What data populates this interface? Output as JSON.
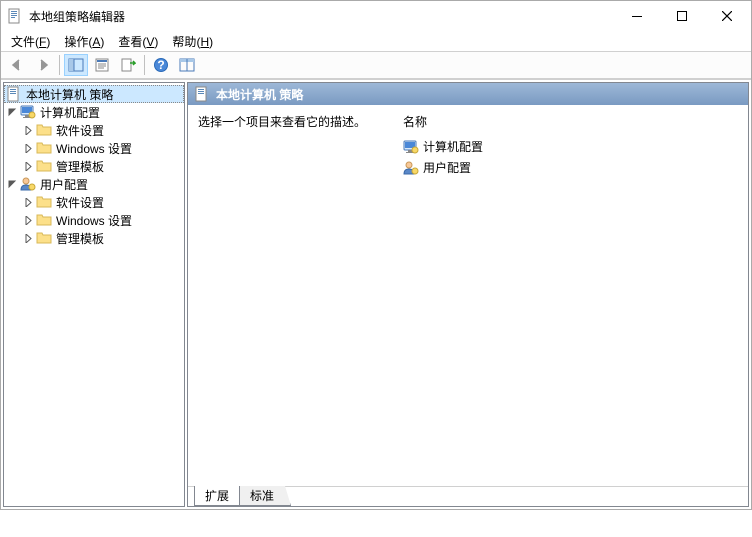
{
  "window": {
    "title": "本地组策略编辑器"
  },
  "menu": {
    "file": {
      "label": "文件",
      "accel": "F"
    },
    "action": {
      "label": "操作",
      "accel": "A"
    },
    "view": {
      "label": "查看",
      "accel": "V"
    },
    "help": {
      "label": "帮助",
      "accel": "H"
    }
  },
  "tree": {
    "root": {
      "label": "本地计算机 策略"
    },
    "computer": {
      "label": "计算机配置"
    },
    "user": {
      "label": "用户配置"
    },
    "software": {
      "label": "软件设置"
    },
    "windows": {
      "label": "Windows 设置"
    },
    "admin": {
      "label": "管理模板"
    }
  },
  "content": {
    "header_title": "本地计算机 策略",
    "description": "选择一个项目来查看它的描述。",
    "list_header": "名称",
    "items": {
      "computer": "计算机配置",
      "user": "用户配置"
    }
  },
  "tabs": {
    "extended": "扩展",
    "standard": "标准"
  }
}
